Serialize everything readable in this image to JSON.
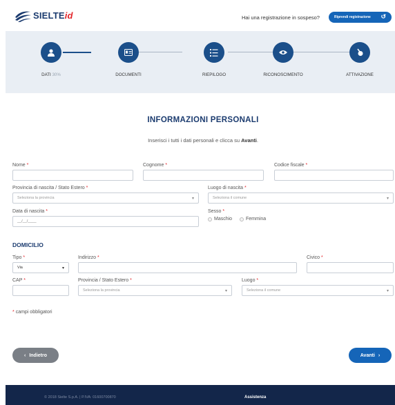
{
  "header": {
    "logo_text": "SIELTE",
    "logo_suffix": "id",
    "pending_text": "Hai una registrazione in sospeso?",
    "resume_button": "Riprendi registrazione",
    "brand_color": "#1b3b6f",
    "accent_color": "#1565b8"
  },
  "steps": [
    {
      "label": "DATI",
      "pct": "30%",
      "icon": "user-icon",
      "active": true
    },
    {
      "label": "DOCUMENTI",
      "icon": "id-card-icon",
      "active": false
    },
    {
      "label": "RIEPILOGO",
      "icon": "list-icon",
      "active": false
    },
    {
      "label": "RICONOSCIMENTO",
      "icon": "eye-icon",
      "active": false
    },
    {
      "label": "ATTIVAZIONE",
      "icon": "key-icon",
      "active": false
    }
  ],
  "form": {
    "title": "INFORMAZIONI PERSONALI",
    "subtitle_pre": "Inserisci i tutti i dati personali e clicca su ",
    "subtitle_bold": "Avanti",
    "subtitle_post": ".",
    "nome_label": "Nome",
    "cognome_label": "Cognome",
    "cf_label": "Codice fiscale",
    "provincia_label": "Provincia di nascita / Stato Estero",
    "provincia_placeholder": "Seleziona la provincia",
    "luogo_label": "Luogo di nascita",
    "luogo_placeholder": "Seleziona il comune",
    "data_label": "Data di nascita",
    "data_placeholder": "__/__/____",
    "sesso_label": "Sesso",
    "sesso_options": [
      "Maschio",
      "Femmina"
    ],
    "asterisk": "*"
  },
  "domicilio": {
    "section_title": "DOMICILIO",
    "tipo_label": "Tipo",
    "tipo_value": "Via",
    "indirizzo_label": "Indirizzo",
    "civico_label": "Civico",
    "cap_label": "CAP",
    "provincia_label": "Provincia / Stato Estero",
    "provincia_placeholder": "Seleziona la provincia",
    "luogo_label": "Luogo",
    "luogo_placeholder": "Seleziona il comune"
  },
  "mandatory_note": "campi obbligatori",
  "nav": {
    "back": "Indietro",
    "next": "Avanti"
  },
  "footer": {
    "copyright": "© 2018 Sielte S.p.A. | P.IVA: 01600700870",
    "assist": "Assistenza"
  }
}
